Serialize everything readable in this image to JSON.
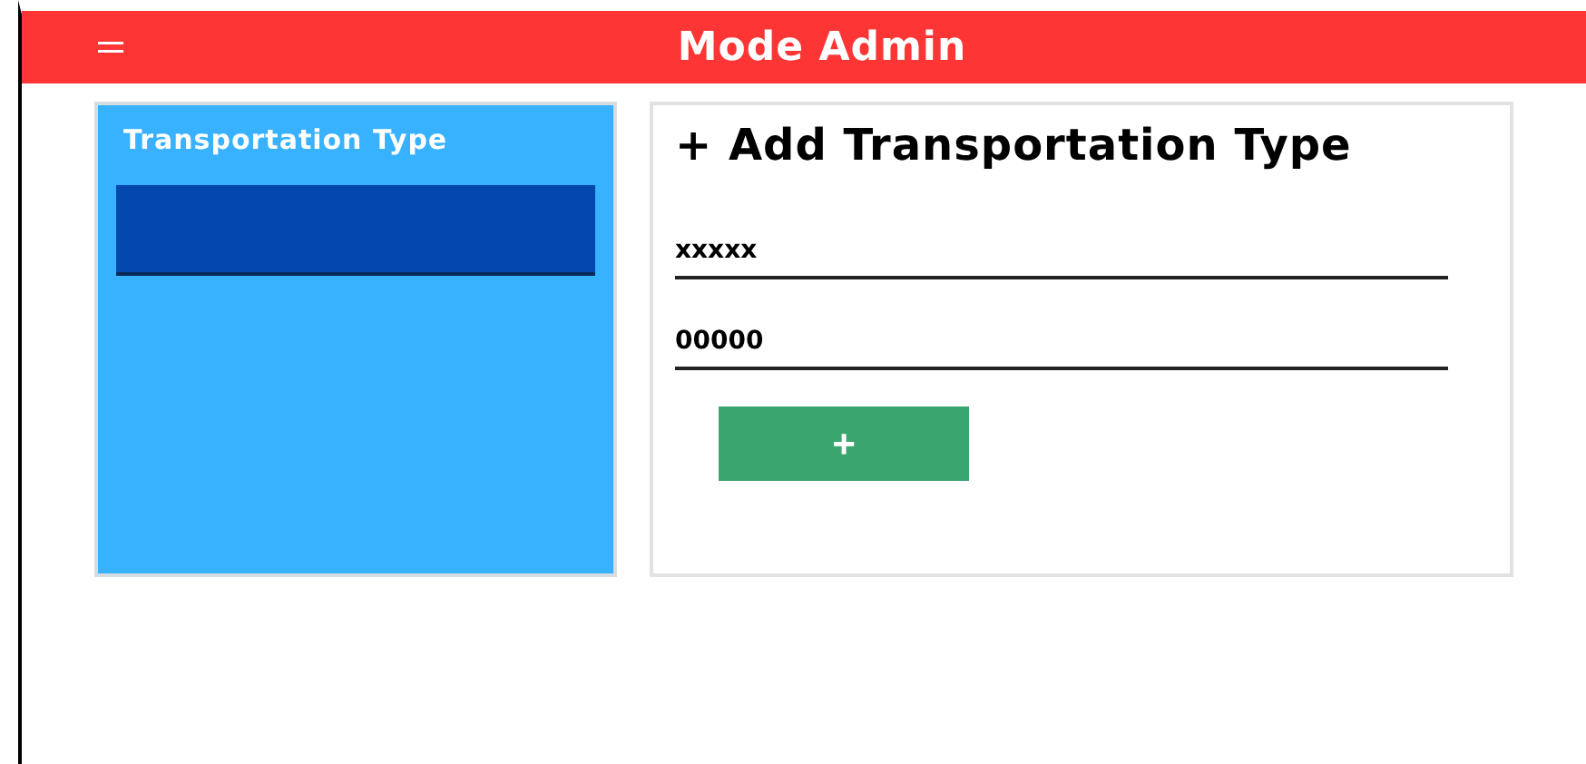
{
  "header": {
    "title": "Mode Admin"
  },
  "sidebar": {
    "title": "Transportation Type"
  },
  "form": {
    "title": "+ Add Transportation Type",
    "fields": [
      {
        "value": "xxxxx"
      },
      {
        "value": "00000"
      }
    ],
    "submit_button": "+"
  }
}
